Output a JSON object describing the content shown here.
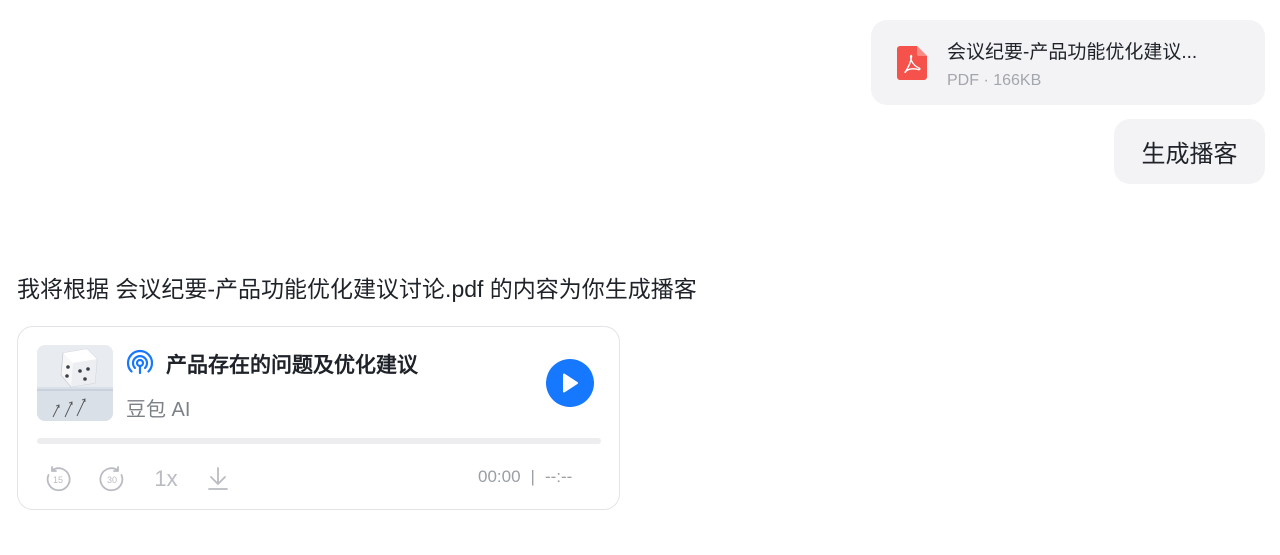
{
  "file_message": {
    "name": "会议纪要-产品功能优化建议...",
    "meta": "PDF · 166KB",
    "icon": "pdf-file-icon",
    "icon_color": "#f5524c"
  },
  "user_message": {
    "text": "生成播客"
  },
  "assistant_message": {
    "text": "我将根据 会议纪要-产品功能优化建议讨论.pdf 的内容为你生成播客"
  },
  "podcast": {
    "title": "产品存在的问题及优化建议",
    "author": "豆包 AI",
    "accent_color": "#1677ff",
    "progress": 0,
    "controls": {
      "rewind_label": "15",
      "forward_label": "30",
      "speed_label": "1x"
    },
    "current_time": "00:00",
    "separator": "|",
    "duration": "--:--"
  }
}
